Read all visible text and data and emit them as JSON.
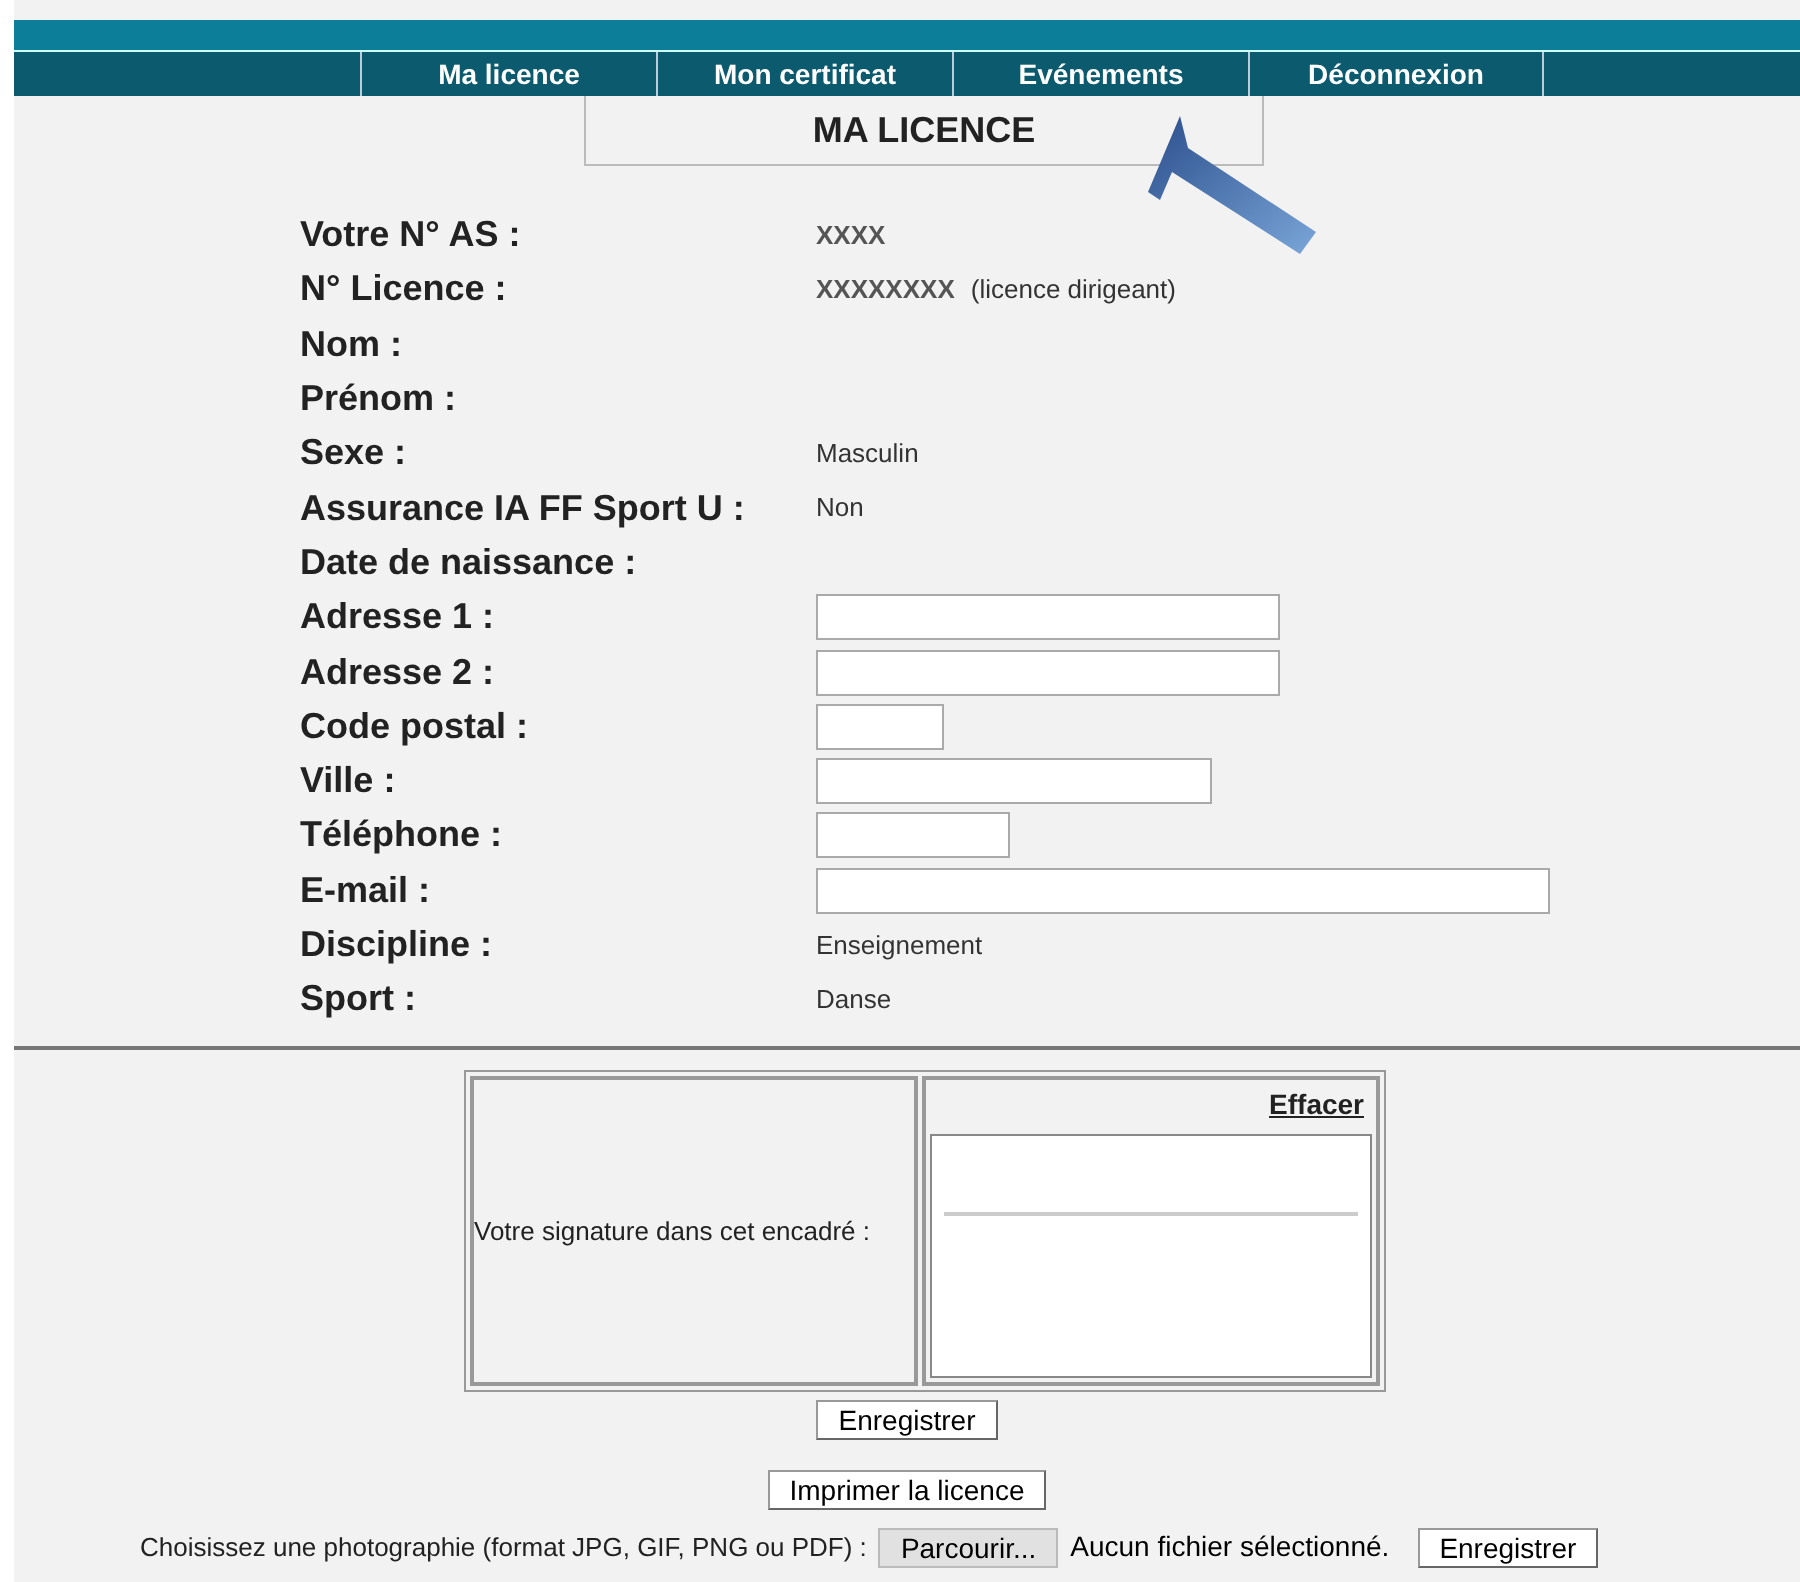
{
  "nav": [
    {
      "label": "Ma licence",
      "selected": false
    },
    {
      "label": "Mon certificat",
      "selected": false
    },
    {
      "label": "Evénements",
      "selected": false
    },
    {
      "label": "Déconnexion",
      "selected": false
    }
  ],
  "page_title": "MA LICENCE",
  "rows": [
    {
      "kind": "text",
      "label": "Votre N° AS :",
      "value": "XXXX"
    },
    {
      "kind": "text",
      "label": "N° Licence :",
      "value": "XXXXXXXX",
      "note": "(licence dirigeant)"
    },
    {
      "kind": "text",
      "label": "Nom :"
    },
    {
      "kind": "text",
      "label": "Prénom :"
    },
    {
      "kind": "text",
      "label": "Sexe :",
      "value": "Masculin"
    },
    {
      "kind": "text",
      "label": "Assurance IA FF Sport U :",
      "value": "Non"
    },
    {
      "kind": "text",
      "label": "Date de naissance :"
    },
    {
      "kind": "field",
      "label": "Adresse 1 :"
    },
    {
      "kind": "field",
      "label": "Adresse 2 :"
    },
    {
      "kind": "field",
      "label": "Code postal :"
    },
    {
      "kind": "field",
      "label": "Ville :"
    },
    {
      "kind": "field",
      "label": "Téléphone :"
    },
    {
      "kind": "field",
      "label": "E-mail :"
    },
    {
      "kind": "text",
      "label": "Discipline :",
      "value": "Enseignement"
    },
    {
      "kind": "text",
      "label": "Sport :",
      "value": "Danse"
    }
  ],
  "signature": {
    "prompt": "Votre signature dans cet encadré :",
    "clear_link": "Effacer"
  },
  "save_button": "Enregistrer",
  "print_button": "Imprimer la licence",
  "photo": {
    "label": "Choisissez une photographie (format JPG, GIF, PNG ou PDF) :",
    "browse_button": "Parcourir...",
    "file_status": "Aucun fichier sélectionné.",
    "save_button": "Enregistrer"
  }
}
